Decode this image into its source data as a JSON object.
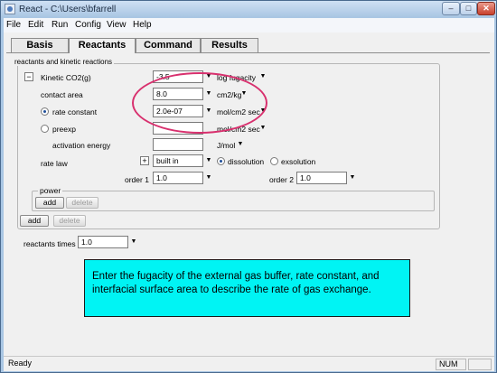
{
  "window": {
    "title": "React - C:\\Users\\bfarrell"
  },
  "menu": [
    "File",
    "Edit",
    "Run",
    "Config",
    "View",
    "Help"
  ],
  "tabs": [
    "Basis",
    "Reactants",
    "Command",
    "Results"
  ],
  "group": {
    "caption": "reactants and kinetic reactions",
    "collapse_symbol": "−",
    "reaction_label": "Kinetic  CO2(g)",
    "fugacity": {
      "value": "-3.5",
      "unit": "log fugacity"
    },
    "contact_area": {
      "label": "contact area",
      "value": "8.0",
      "unit": "cm2/kg"
    },
    "rate_constant": {
      "label": "rate constant",
      "value": "2.0e-07",
      "unit": "mol/cm2 sec"
    },
    "preexp": {
      "label": "preexp",
      "value": "",
      "unit": "mol/cm2 sec"
    },
    "activation_energy": {
      "label": "activation energy",
      "value": "",
      "unit": "J/mol"
    },
    "rate_law": {
      "label": "rate law",
      "plus": "+",
      "value": "built in",
      "dissolution": "dissolution",
      "exsolution": "exsolution"
    },
    "order1": {
      "label": "order 1",
      "value": "1.0"
    },
    "order2": {
      "label": "order 2",
      "value": "1.0"
    },
    "power": {
      "caption": "power",
      "add": "add",
      "delete": "delete"
    },
    "add": "add",
    "delete": "delete"
  },
  "reactants_times": {
    "label": "reactants times",
    "value": "1.0"
  },
  "callout": "Enter the fugacity of the external gas buffer, rate constant, and interfacial surface area to describe the rate of gas exchange.",
  "status": {
    "left": "Ready",
    "num": "NUM"
  },
  "colors": {
    "highlight_ellipse": "#d8306e",
    "callout_bg": "#00f4f4",
    "window_frame": "#a9c6e3"
  }
}
